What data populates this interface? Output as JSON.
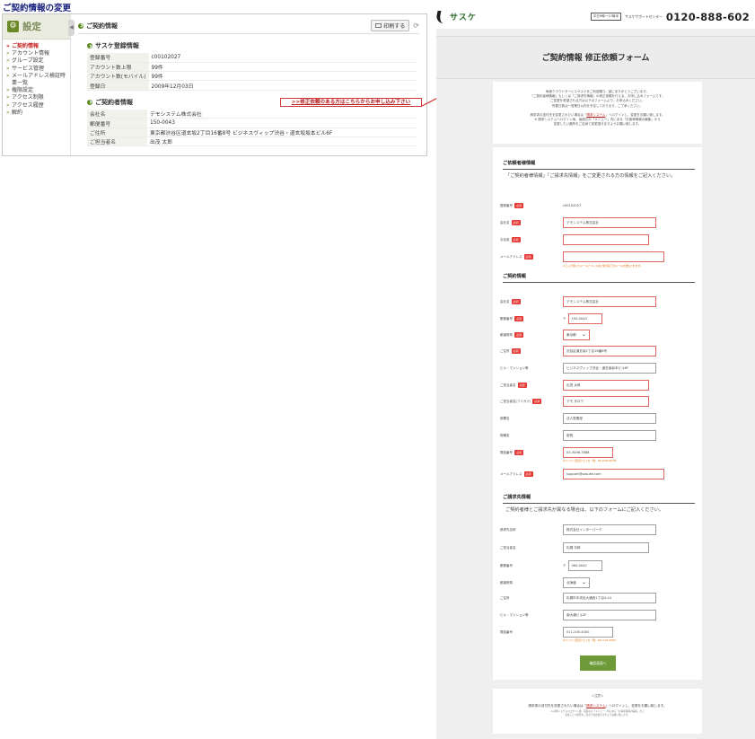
{
  "page_title": "ご契約情報の変更",
  "admin": {
    "side_title": "設定",
    "nav": [
      {
        "label": "ご契約情報",
        "active": true
      },
      {
        "label": "アカウント情報",
        "active": false
      },
      {
        "label": "グループ設定",
        "active": false
      },
      {
        "label": "サービス管理",
        "active": false
      },
      {
        "label": "メールアドレス検証時業一覧",
        "active": false
      },
      {
        "label": "権限設定",
        "active": false
      },
      {
        "label": "アクセス制限",
        "active": false
      },
      {
        "label": "アクセス履歴",
        "active": false
      },
      {
        "label": "解約",
        "active": false
      }
    ],
    "section_title": "ご契約情報",
    "print_label": "印刷する",
    "registration_title": "サスケ登録情報",
    "registration_rows": [
      {
        "k": "登録番号",
        "v": "c00102027"
      },
      {
        "k": "アカウント数上限",
        "v": "99件"
      },
      {
        "k": "アカウント数(モバイル)",
        "v": "99件"
      },
      {
        "k": "登録日",
        "v": "2009年12月03日"
      }
    ],
    "contractor_title": "ご契約者情報",
    "contractor_rows": [
      {
        "k": "会社名",
        "v": "デモシステム株式会社"
      },
      {
        "k": "郵便番号",
        "v": "150-0043"
      },
      {
        "k": "ご住所",
        "v": "東京都渋谷区道玄坂2丁目16番8号 ビジネスヴィップ渋谷・道玄坂坂本ビル6F"
      },
      {
        "k": "ご担当者名",
        "v": "出茂 太郎"
      }
    ],
    "request_link": ">>修正依頼のある方はこちらからお申し込み下さい"
  },
  "site": {
    "logo_text": "サスケ",
    "hours_badge": "平日9時〜17時半",
    "support_label": "サスケサポートセンター",
    "phone": "0120-888-602",
    "hero_title": "ご契約情報 修正依頼フォーム",
    "intro_lines": [
      "毎度クラウドサービスサスケをご利用賜り、誠にありがとうございます。",
      "「ご契約者様情報」もしくは「ご請求先情報」の修正依頼を行える、お申し込みフォームです。",
      "ご変更を希望される方は以下のフォームより、お申込みください。",
      "所要日数は一営業日以内を予定しております。ご了承ください。"
    ],
    "intro_login_text_a": "請求書の送付先を変更されたい場合は「",
    "intro_login_link": "請求システム",
    "intro_login_text_b": "」へログインし、変更をお願い致します。",
    "intro_sub_lines": [
      "※ 請求システムへログイン後、画面左の「メニュー」内にある「お客様情報の編集」から",
      "変更したい箇所をご自身で変更頂きますようお願い致します。"
    ],
    "requester": {
      "heading": "ご依頼者様情報",
      "note": "「ご契約者様情報」「ご請求先情報」をご変更される方の情報をご記入ください。",
      "reg_no_label": "登録番号",
      "reg_no_value": "c00102027",
      "company_label": "会社名",
      "company_value": "デモシステム株式会社",
      "name_label": "お名前",
      "name_value": "",
      "email_label": "メールアドレス",
      "email_value": "",
      "email_hint": "※ご入力頂いたメールアドレス宛に受付完了のメールが送信されます。"
    },
    "contract": {
      "heading": "ご契約情報",
      "company_label": "会社名",
      "company_value": "デモシステム株式会社",
      "zip_label": "郵便番号",
      "zip_mark": "〒",
      "zip_value": "150-0043",
      "pref_label": "都道府県",
      "pref_value": "東京都",
      "address_label": "ご住所",
      "address_value": "渋谷区道玄坂2丁目16番8号",
      "building_label": "ビル・マンション等",
      "building_value": "ビジネスヴィップ渋谷・道玄坂坂本ビル6F",
      "person_label": "ご担当者名",
      "person_value": "出茂 太郎",
      "kana_label": "ご担当者名(フリガナ)",
      "kana_value": "デモ タロウ",
      "dept_label": "部署名",
      "dept_value": "法人営業部",
      "title_label": "役職名",
      "title_value": "部長",
      "phone_label": "電話番号",
      "phone_value": "03-3496-7888",
      "phone_hint": "※ハイフン区切りで入力（例：03-1234-5678）",
      "email_label": "メールアドレス",
      "email_value": "support@sasuke.com"
    },
    "billing": {
      "heading": "ご請求先情報",
      "note": "ご契約者様とご請求先が異なる場合は、以下のフォームにご記入ください。",
      "name_label": "請求先名称",
      "name_value": "株式会社インターパーク",
      "person_label": "ご担当者名",
      "person_value": "札幌 次郎",
      "zip_label": "郵便番号",
      "zip_mark": "〒",
      "zip_value": "060-0042",
      "pref_label": "都道府県",
      "pref_value": "北海道",
      "address_label": "ご住所",
      "address_value": "札幌市中央区大通西1丁目4-14",
      "building_label": "ビル・マンション等",
      "building_value": "南大通ビル2F",
      "phone_label": "電話番号",
      "phone_value": "011-200-4000",
      "phone_hint": "※ハイフン区切りで入力（例：011-123-4567）"
    },
    "confirm_label": "確認画面へ",
    "notice_title": "＜注意＞",
    "notice_text_a": "請求書の送付先を変更されたい場合は「",
    "notice_link": "請求システム",
    "notice_text_b": "」へログインし、変更をお願い致します。",
    "notice_sub_lines": [
      "※ 請求システムへログイン後、画面左の「メニュー」内にある「お客様情報の編集」から",
      "変更したい箇所をご自身で変更頂きますようお願い致します。"
    ]
  },
  "colors": {
    "accent_green": "#6e9a3a",
    "required_red": "#e53935",
    "arrow_red": "#d32f2f"
  }
}
